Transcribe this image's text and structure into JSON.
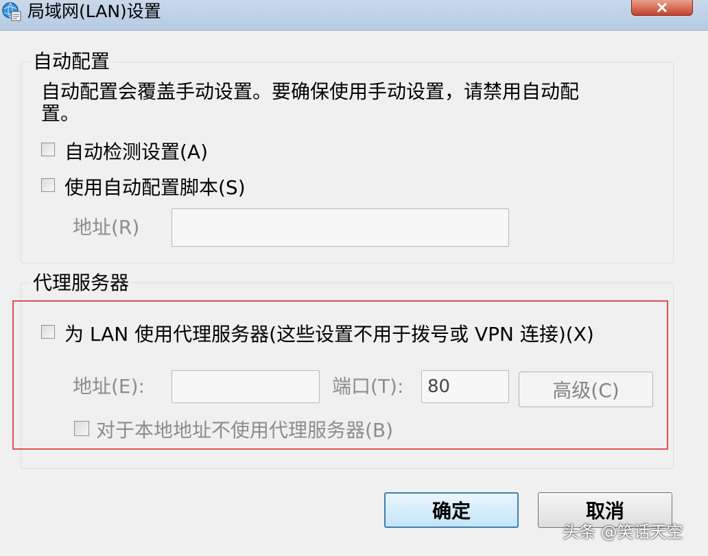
{
  "window": {
    "title": "局域网(LAN)设置"
  },
  "auto_config": {
    "group_title": "自动配置",
    "description_line1": "自动配置会覆盖手动设置。要确保使用手动设置，请禁用自动配",
    "description_line2": "置。",
    "auto_detect_label": "自动检测设置(A)",
    "auto_detect_checked": false,
    "use_script_label": "使用自动配置脚本(S)",
    "use_script_checked": false,
    "address_label": "地址(R)",
    "address_value": ""
  },
  "proxy": {
    "group_title": "代理服务器",
    "use_proxy_label": "为 LAN 使用代理服务器(这些设置不用于拨号或 VPN 连接)(X)",
    "use_proxy_checked": false,
    "address_label": "地址(E):",
    "address_value": "",
    "port_label": "端口(T):",
    "port_value": "80",
    "advanced_label": "高级(C)",
    "bypass_local_label": "对于本地地址不使用代理服务器(B)",
    "bypass_local_checked": false
  },
  "buttons": {
    "ok": "确定",
    "cancel": "取消"
  },
  "watermark": "头条 @笑话天空",
  "colors": {
    "highlight": "#d9534f",
    "close": "#c7412b",
    "default_button": "#3c7fb1"
  }
}
